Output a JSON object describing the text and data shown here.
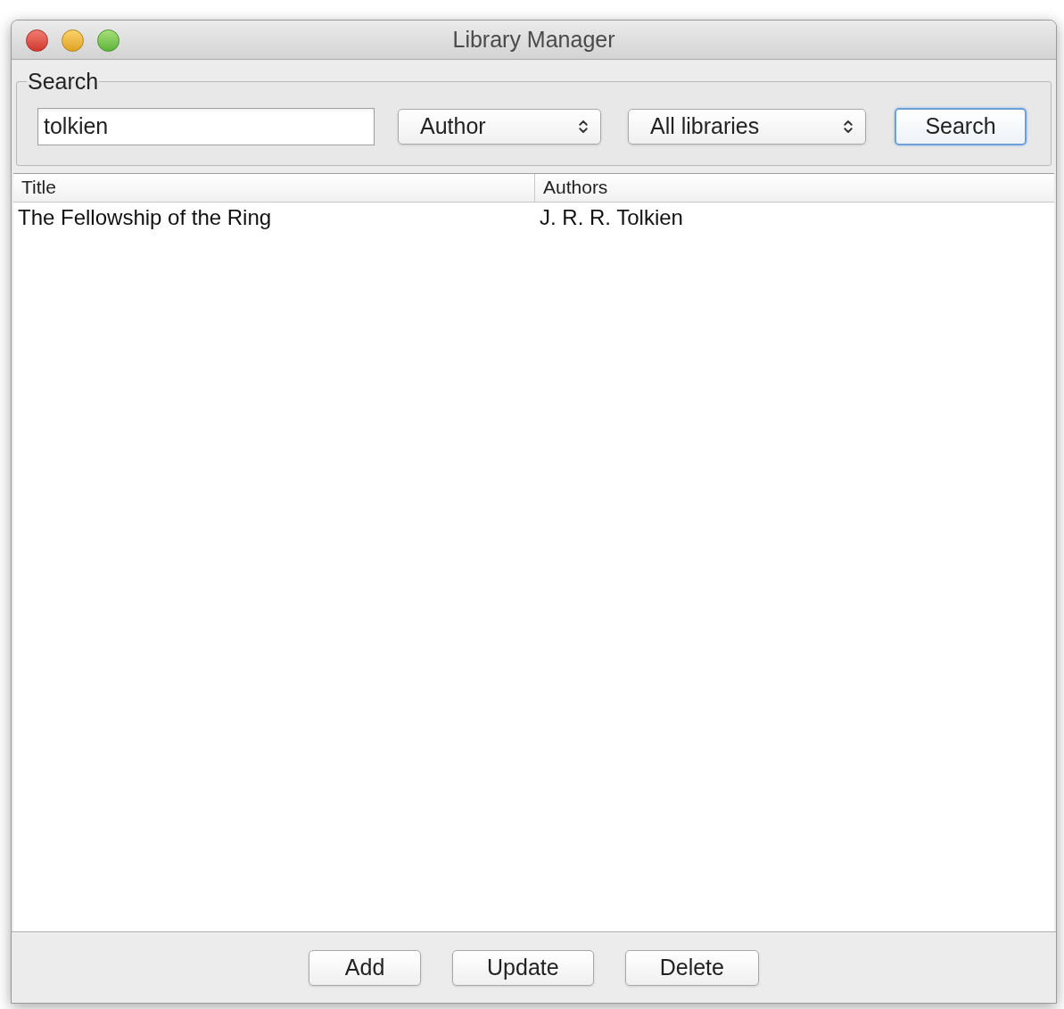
{
  "window": {
    "title": "Library Manager"
  },
  "search_group": {
    "legend": "Search",
    "query": {
      "value": "tolkien"
    },
    "field_select": {
      "value": "Author"
    },
    "library_select": {
      "value": "All libraries"
    },
    "button": {
      "label": "Search",
      "default": true
    }
  },
  "table": {
    "columns": [
      "Title",
      "Authors"
    ],
    "rows": [
      {
        "cells": [
          "The Fellowship of the Ring",
          "J. R. R. Tolkien"
        ],
        "selected": false
      }
    ]
  },
  "buttons": [
    "Add",
    "Update",
    "Delete"
  ]
}
